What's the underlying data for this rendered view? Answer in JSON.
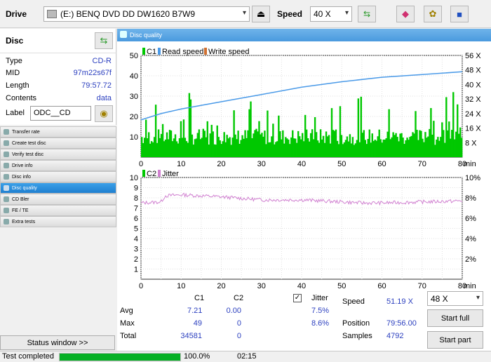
{
  "toolbar": {
    "drive_label": "Drive",
    "drive_value": "(E:)   BENQ DVD DD DW1620 B7W9",
    "speed_label": "Speed",
    "speed_value": "40 X"
  },
  "disc": {
    "title": "Disc",
    "type_label": "Type",
    "type_value": "CD-R",
    "mid_label": "MID",
    "mid_value": "97m22s67f",
    "length_label": "Length",
    "length_value": "79:57.72",
    "contents_label": "Contents",
    "contents_value": "data",
    "label_label": "Label",
    "label_value": "ODC__CD"
  },
  "menu": [
    {
      "label": "Transfer rate"
    },
    {
      "label": "Create test disc"
    },
    {
      "label": "Verify test disc"
    },
    {
      "label": "Drive info"
    },
    {
      "label": "Disc info"
    },
    {
      "label": "Disc quality"
    },
    {
      "label": "CD Bler"
    },
    {
      "label": "FE / TE"
    },
    {
      "label": "Extra tests"
    }
  ],
  "status_window_label": "Status window >>",
  "main_title": "Disc quality",
  "chart1": {
    "legend": [
      "C1",
      "Read speed",
      "Write speed"
    ],
    "y_left": [
      "50",
      "40",
      "30",
      "20",
      "10"
    ],
    "y_right": [
      "56 X",
      "48 X",
      "40 X",
      "32 X",
      "24 X",
      "16 X",
      "8 X"
    ],
    "x_ticks": [
      "0",
      "10",
      "20",
      "30",
      "40",
      "50",
      "60",
      "70",
      "80"
    ],
    "x_unit": "min"
  },
  "chart2": {
    "legend": [
      "C2",
      "Jitter"
    ],
    "y_left": [
      "10",
      "9",
      "8",
      "7",
      "6",
      "5",
      "4",
      "3",
      "2",
      "1"
    ],
    "y_right": [
      "10%",
      "8%",
      "6%",
      "4%",
      "2%"
    ],
    "x_ticks": [
      "0",
      "10",
      "20",
      "30",
      "40",
      "50",
      "60",
      "70",
      "80"
    ],
    "x_unit": "min"
  },
  "stats": {
    "col_c1": "C1",
    "col_c2": "C2",
    "jitter_label": "Jitter",
    "avg_label": "Avg",
    "avg_c1": "7.21",
    "avg_c2": "0.00",
    "avg_jitter": "7.5%",
    "max_label": "Max",
    "max_c1": "49",
    "max_c2": "0",
    "max_jitter": "8.6%",
    "total_label": "Total",
    "total_c1": "34581",
    "total_c2": "0",
    "speed_label": "Speed",
    "speed_value": "51.19 X",
    "position_label": "Position",
    "position_value": "79:56.00",
    "samples_label": "Samples",
    "samples_value": "4792",
    "speed_select": "48 X",
    "start_full": "Start full",
    "start_part": "Start part"
  },
  "status": {
    "text": "Test completed",
    "progress": 1.0,
    "percent": "100.0%",
    "time": "02:15"
  },
  "chart_data": [
    {
      "type": "bar",
      "series": [
        {
          "name": "C1",
          "color": "#00c800"
        },
        {
          "name": "Read speed",
          "color": "#4a9ae8",
          "x": [
            0,
            5,
            10,
            20,
            30,
            40,
            50,
            60,
            70,
            80
          ],
          "values": [
            20.5,
            24,
            26.5,
            30.5,
            34.5,
            38.5,
            41.5,
            44,
            45.5,
            47
          ]
        },
        {
          "name": "Write speed",
          "color": "#d07030"
        }
      ],
      "xlim": [
        0,
        80
      ],
      "ylim": [
        0,
        50
      ],
      "y2lim": [
        0,
        56
      ],
      "grid": true
    },
    {
      "type": "line",
      "series": [
        {
          "name": "C2",
          "color": "#00c800",
          "x": [
            0,
            80
          ],
          "values": [
            0,
            0
          ]
        },
        {
          "name": "Jitter",
          "color": "#d080d0",
          "x": [
            0,
            5,
            6,
            10,
            20,
            30,
            40,
            50,
            55,
            60,
            70,
            80
          ],
          "values": [
            7.5,
            7.6,
            8.2,
            8.3,
            8.1,
            7.8,
            7.8,
            7.6,
            7.5,
            7.5,
            7.6,
            7.7
          ]
        }
      ],
      "xlim": [
        0,
        80
      ],
      "ylim": [
        0,
        10
      ],
      "y2lim": [
        0,
        10
      ],
      "grid": true
    }
  ]
}
